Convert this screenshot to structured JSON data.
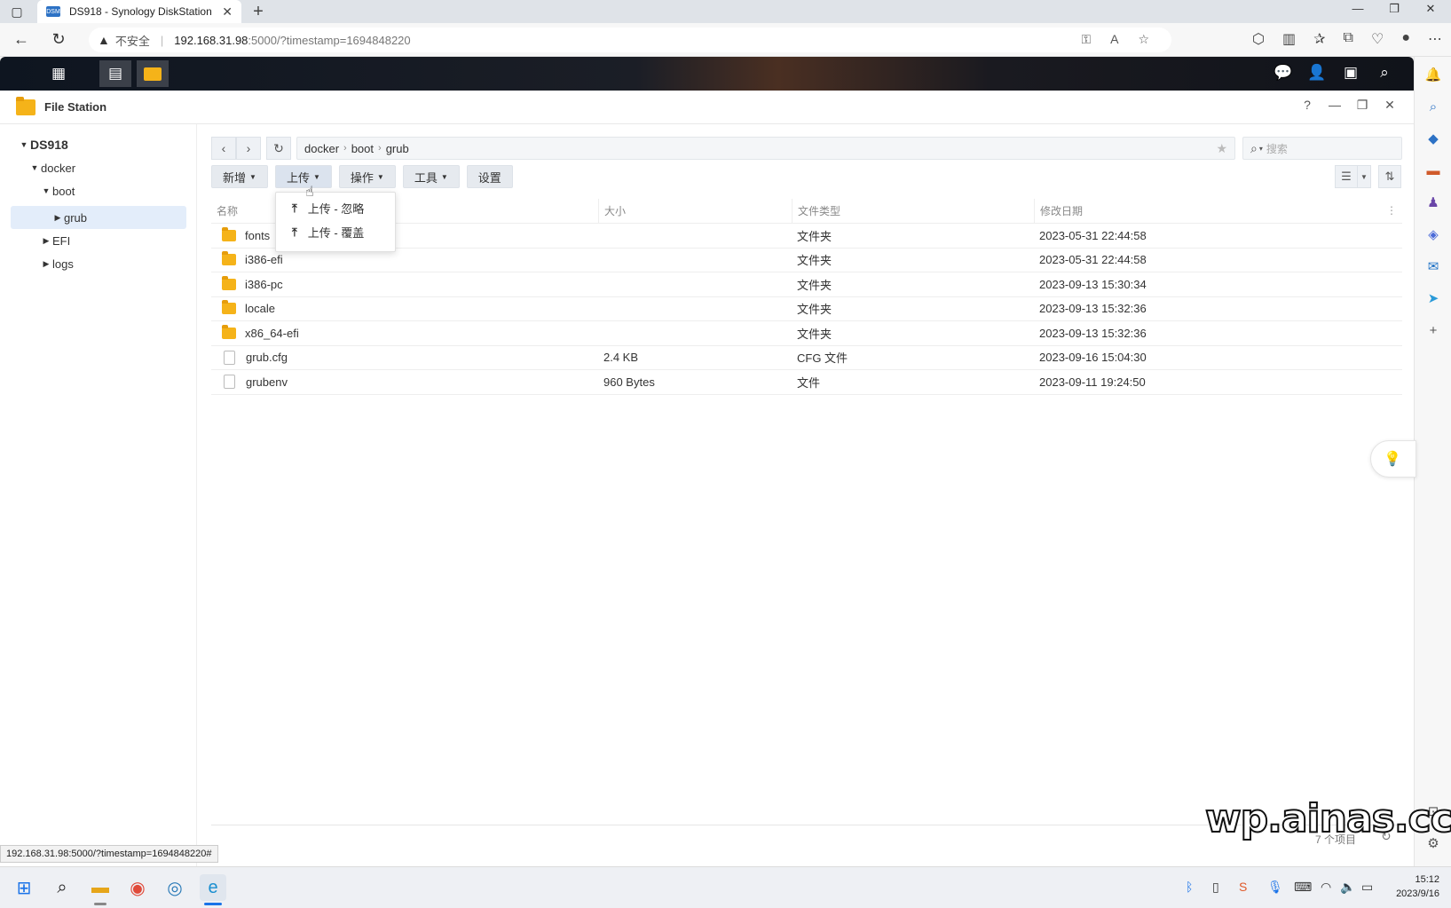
{
  "browser": {
    "tab_title": "DS918 - Synology DiskStation",
    "tab_favicon": "DSM",
    "security_label": "不安全",
    "url_host": "192.168.31.98",
    "url_path": ":5000/?timestamp=1694848220",
    "status_url": "192.168.31.98:5000/?timestamp=1694848220#"
  },
  "file_station": {
    "title": "File Station",
    "tree": {
      "root": "DS918",
      "items": [
        "docker",
        "boot",
        "grub",
        "EFI",
        "logs"
      ]
    },
    "breadcrumb": [
      "docker",
      "boot",
      "grub"
    ],
    "search_placeholder": "搜索",
    "toolbar": {
      "new": "新增",
      "upload": "上传",
      "action": "操作",
      "tools": "工具",
      "settings": "设置"
    },
    "upload_menu": [
      "上传 - 忽略",
      "上传 - 覆盖"
    ],
    "columns": {
      "name": "名称",
      "size": "大小",
      "type": "文件类型",
      "date": "修改日期"
    },
    "files": [
      {
        "name": "fonts",
        "size": "",
        "type": "文件夹",
        "date": "2023-05-31 22:44:58",
        "kind": "folder"
      },
      {
        "name": "i386-efi",
        "size": "",
        "type": "文件夹",
        "date": "2023-05-31 22:44:58",
        "kind": "folder"
      },
      {
        "name": "i386-pc",
        "size": "",
        "type": "文件夹",
        "date": "2023-09-13 15:30:34",
        "kind": "folder"
      },
      {
        "name": "locale",
        "size": "",
        "type": "文件夹",
        "date": "2023-09-13 15:32:36",
        "kind": "folder"
      },
      {
        "name": "x86_64-efi",
        "size": "",
        "type": "文件夹",
        "date": "2023-09-13 15:32:36",
        "kind": "folder"
      },
      {
        "name": "grub.cfg",
        "size": "2.4 KB",
        "type": "CFG 文件",
        "date": "2023-09-16 15:04:30",
        "kind": "file"
      },
      {
        "name": "grubenv",
        "size": "960 Bytes",
        "type": "文件",
        "date": "2023-09-11 19:24:50",
        "kind": "file"
      }
    ],
    "footer_count": "7 个项目"
  },
  "watermark": "wp.ainas.cc",
  "taskbar": {
    "time": "15:12",
    "date": "2023/9/16"
  },
  "colors": {
    "accent": "#2d72c5",
    "folder": "#f5b319",
    "selection": "#e3edfa"
  }
}
